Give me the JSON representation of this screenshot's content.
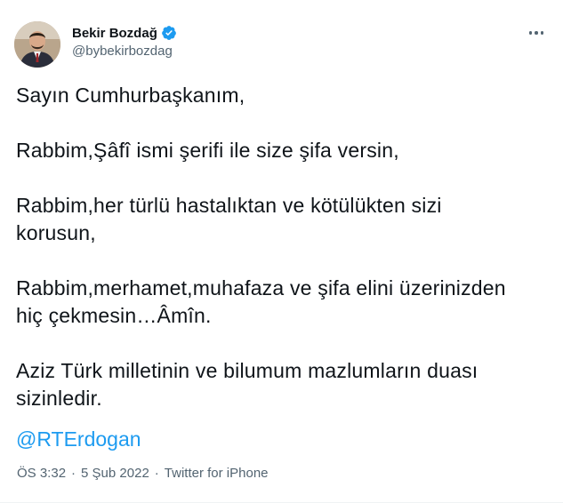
{
  "user": {
    "display_name": "Bekir Bozdağ",
    "handle": "@bybekirbozdag",
    "verified": true,
    "avatar_icon": "profile-photo",
    "verified_icon": "verified-badge-icon"
  },
  "tweet": {
    "paragraphs": [
      "Sayın Cumhurbaşkanım,",
      "Rabbim,Şâfî ismi şerifi ile size şifa versin,",
      "Rabbim,her türlü hastalıktan ve kötülükten sizi\nkorusun,",
      "Rabbim,merhamet,muhafaza ve şifa elini üzerinizden\nhiç çekmesin…Âmîn.",
      "Aziz Türk milletinin ve bilumum mazlumların duası\nsizinledir."
    ],
    "mention": "@RTErdogan"
  },
  "meta": {
    "time": "ÖS 3:32",
    "separator": "·",
    "date": "5 Şub 2022",
    "source": "Twitter for iPhone"
  },
  "colors": {
    "link": "#1d9bf0",
    "secondary_text": "#536471",
    "primary_text": "#0f1419"
  },
  "menu_icon": "more-dots-icon"
}
